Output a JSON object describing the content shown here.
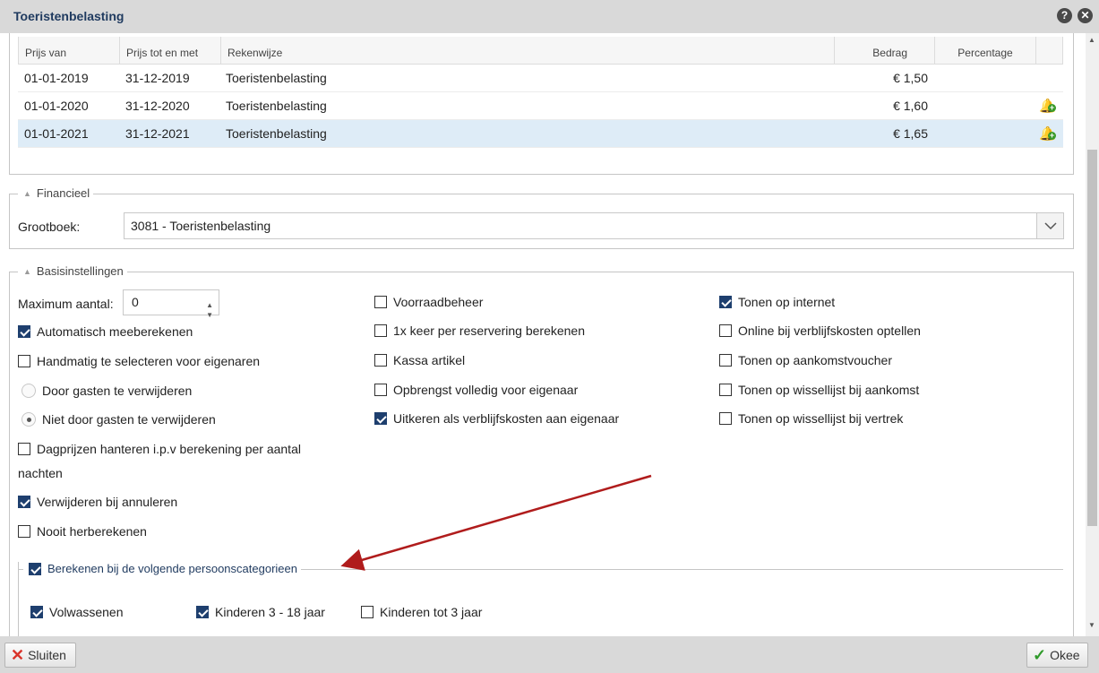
{
  "window": {
    "title": "Toeristenbelasting"
  },
  "price_table": {
    "columns": {
      "from": "Prijs van",
      "to": "Prijs tot en met",
      "method": "Rekenwijze",
      "amount": "Bedrag",
      "percentage": "Percentage"
    },
    "rows": [
      {
        "from": "01-01-2019",
        "to": "31-12-2019",
        "method": "Toeristenbelasting",
        "amount": "€ 1,50"
      },
      {
        "from": "01-01-2020",
        "to": "31-12-2020",
        "method": "Toeristenbelasting",
        "amount": "€ 1,60"
      },
      {
        "from": "01-01-2021",
        "to": "31-12-2021",
        "method": "Toeristenbelasting",
        "amount": "€ 1,65"
      }
    ]
  },
  "financial": {
    "legend": "Financieel",
    "ledger_label": "Grootboek:",
    "ledger_value": "3081 - Toeristenbelasting"
  },
  "basic": {
    "legend": "Basisinstellingen",
    "max_label": "Maximum aantal:",
    "max_value": "0",
    "col1": {
      "auto": "Automatisch meeberekenen",
      "manual": "Handmatig te selecteren voor eigenaren",
      "radio_remove": "Door gasten te verwijderen",
      "radio_noremove": "Niet door gasten te verwijderen",
      "daily_line1": "Dagprijzen hanteren i.p.v berekening per aantal",
      "daily_line2": "nachten",
      "cancel": "Verwijderen bij annuleren",
      "never": "Nooit herberekenen"
    },
    "col2": {
      "stock": "Voorraadbeheer",
      "once": "1x keer per reservering berekenen",
      "pos": "Kassa artikel",
      "revenue": "Opbrengst volledig voor eigenaar",
      "payout": "Uitkeren als verblijfskosten aan eigenaar"
    },
    "col3": {
      "internet": "Tonen op internet",
      "online": "Online bij verblijfskosten optellen",
      "voucher": "Tonen op aankomstvoucher",
      "arrival": "Tonen op wissellijst bij aankomst",
      "departure": "Tonen op wissellijst bij vertrek"
    }
  },
  "persons": {
    "legend": "Berekenen bij de volgende persoonscategorieen",
    "adults": "Volwassenen",
    "children": "Kinderen 3 - 18 jaar",
    "toddlers": "Kinderen tot 3 jaar"
  },
  "footer": {
    "close": "Sluiten",
    "ok": "Okee"
  },
  "colors": {
    "accent": "#1e3f6e",
    "arrow": "#b01c1c",
    "selected_row": "#deecf7"
  }
}
